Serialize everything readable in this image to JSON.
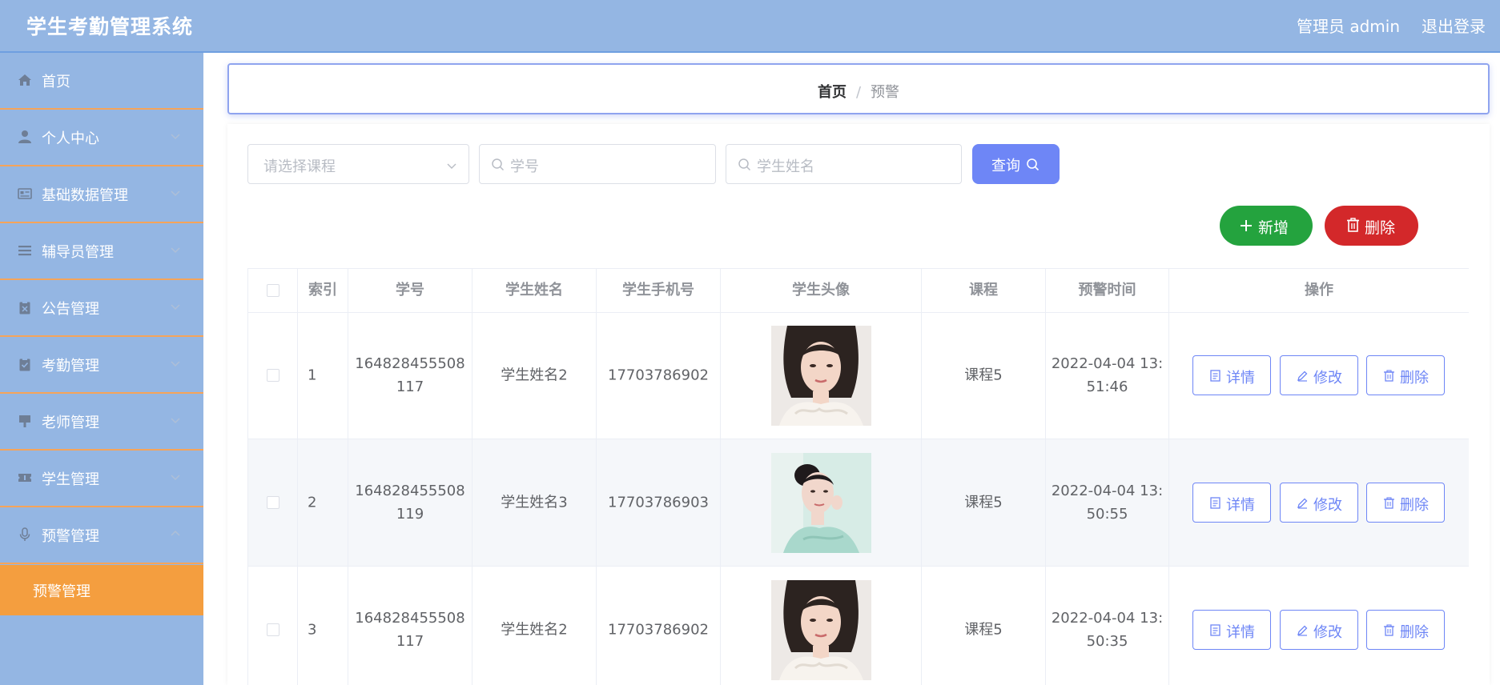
{
  "header": {
    "app_title": "学生考勤管理系统",
    "user_label": "管理员 admin",
    "logout_label": "退出登录"
  },
  "sidebar": {
    "items": [
      {
        "label": "首页",
        "icon": "home-icon",
        "has_chevron": false
      },
      {
        "label": "个人中心",
        "icon": "user-icon",
        "has_chevron": true
      },
      {
        "label": "基础数据管理",
        "icon": "id-card-icon",
        "has_chevron": true
      },
      {
        "label": "辅导员管理",
        "icon": "list-icon",
        "has_chevron": true
      },
      {
        "label": "公告管理",
        "icon": "clipboard-icon",
        "has_chevron": true
      },
      {
        "label": "考勤管理",
        "icon": "clipboard-check-icon",
        "has_chevron": true
      },
      {
        "label": "老师管理",
        "icon": "brush-icon",
        "has_chevron": true
      },
      {
        "label": "学生管理",
        "icon": "ticket-icon",
        "has_chevron": true
      },
      {
        "label": "预警管理",
        "icon": "microphone-icon",
        "has_chevron": true,
        "expanded": true
      }
    ],
    "sub_items": [
      {
        "label": "预警管理",
        "active": true
      }
    ],
    "active_color": "#f49e3f"
  },
  "breadcrumb": {
    "home": "首页",
    "separator": "/",
    "current": "预警"
  },
  "filters": {
    "course_placeholder": "请选择课程",
    "student_no_placeholder": "学号",
    "student_name_placeholder": "学生姓名",
    "query_label": "查询"
  },
  "actions": {
    "add_label": "新增",
    "delete_label": "删除"
  },
  "table": {
    "columns": [
      "索引",
      "学号",
      "学生姓名",
      "学生手机号",
      "学生头像",
      "课程",
      "预警时间",
      "操作"
    ],
    "rows": [
      {
        "index": "1",
        "student_no_1": "164828455508",
        "student_no_2": "117",
        "name": "学生姓名2",
        "phone": "17703786902",
        "course": "课程5",
        "time_1": "2022-04-04 13:",
        "time_2": "51:46"
      },
      {
        "index": "2",
        "student_no_1": "164828455508",
        "student_no_2": "119",
        "name": "学生姓名3",
        "phone": "17703786903",
        "course": "课程5",
        "time_1": "2022-04-04 13:",
        "time_2": "50:55"
      },
      {
        "index": "3",
        "student_no_1": "164828455508",
        "student_no_2": "117",
        "name": "学生姓名2",
        "phone": "17703786902",
        "course": "课程5",
        "time_1": "2022-04-04 13:",
        "time_2": "50:35"
      }
    ],
    "row_actions": {
      "detail": "详情",
      "edit": "修改",
      "delete": "删除"
    }
  },
  "colors": {
    "header_bg": "#94b6e3",
    "primary": "#6e86f6",
    "success": "#24a33e",
    "danger": "#d3282a"
  }
}
